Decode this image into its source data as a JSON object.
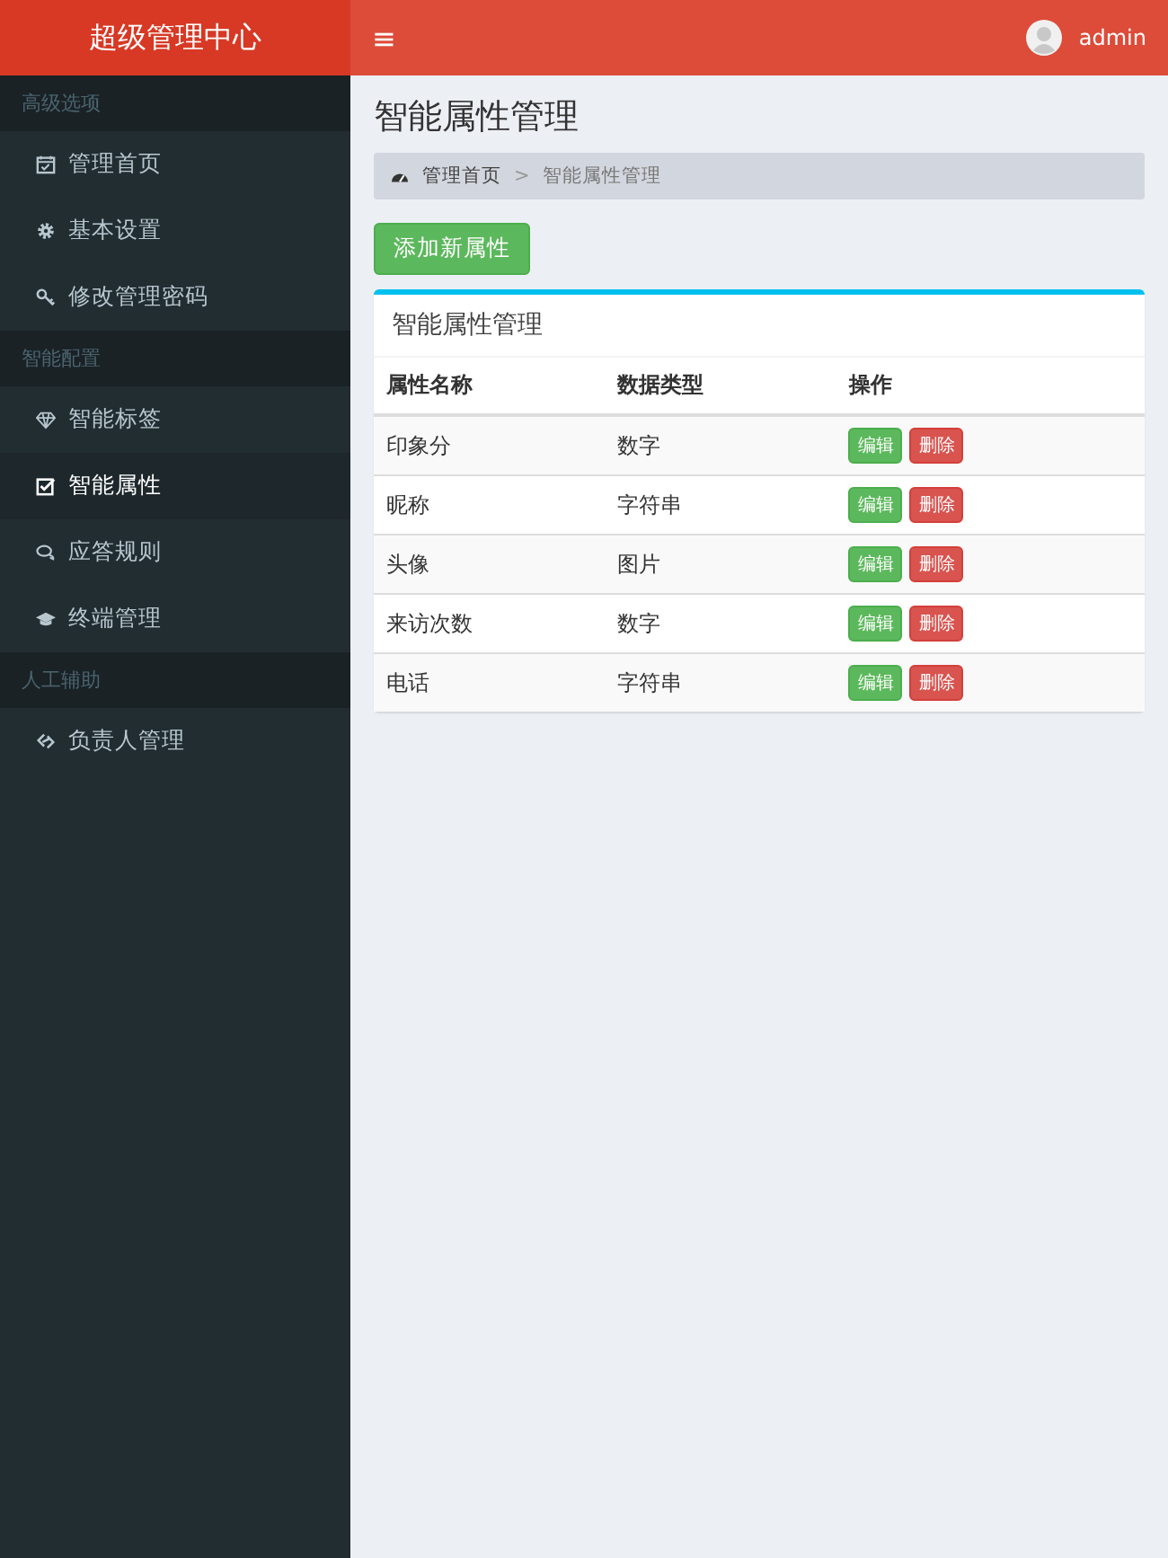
{
  "brand": {
    "title": "超级管理中心"
  },
  "navbar": {
    "menu_icon": "≡",
    "user": "admin"
  },
  "sidebar": {
    "sections": [
      {
        "header": "高级选项",
        "items": [
          {
            "label": "管理首页",
            "kind": "calendar",
            "selected": false
          },
          {
            "label": "基本设置",
            "kind": "gear",
            "selected": false
          },
          {
            "label": "修改管理密码",
            "kind": "key",
            "selected": false
          }
        ]
      },
      {
        "header": "智能配置",
        "items": [
          {
            "label": "智能标签",
            "kind": "diamond",
            "selected": false
          },
          {
            "label": "智能属性",
            "kind": "checkbox",
            "selected": true
          },
          {
            "label": "应答规则",
            "kind": "chat",
            "selected": false
          },
          {
            "label": "终端管理",
            "kind": "cap",
            "selected": false
          }
        ]
      },
      {
        "header": "人工辅助",
        "items": [
          {
            "label": "负责人管理",
            "kind": "link",
            "selected": false
          }
        ]
      }
    ]
  },
  "page": {
    "title": "智能属性管理",
    "breadcrumb": [
      "管理首页",
      ">",
      "智能属性管理"
    ],
    "add_button": "添加新属性"
  },
  "box": {
    "title": "智能属性管理",
    "columns": [
      "属性名称",
      "数据类型",
      "操作"
    ],
    "rows": [
      {
        "name": "印象分",
        "type": "数字",
        "actions": [
          "编辑",
          "删除"
        ]
      },
      {
        "name": "昵称",
        "type": "字符串",
        "actions": [
          "编辑",
          "删除"
        ]
      },
      {
        "name": "头像",
        "type": "图片",
        "actions": [
          "编辑",
          "删除"
        ]
      },
      {
        "name": "来访次数",
        "type": "数字",
        "actions": [
          "编辑",
          "删除"
        ]
      },
      {
        "name": "电话",
        "type": "字符串",
        "actions": [
          "编辑",
          "删除"
        ]
      }
    ]
  }
}
